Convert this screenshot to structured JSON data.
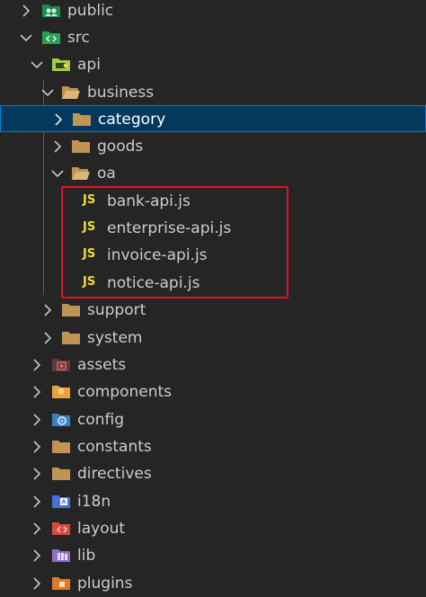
{
  "explorer": {
    "items": [
      {
        "label": "public",
        "icon": "folder-public-icon",
        "expanded": false
      },
      {
        "label": "src",
        "icon": "folder-src-icon",
        "expanded": true
      },
      {
        "label": "api",
        "icon": "folder-api-icon",
        "expanded": true
      },
      {
        "label": "business",
        "icon": "folder-icon",
        "expanded": true
      },
      {
        "label": "category",
        "icon": "folder-icon",
        "expanded": false,
        "selected": true
      },
      {
        "label": "goods",
        "icon": "folder-icon",
        "expanded": false
      },
      {
        "label": "oa",
        "icon": "folder-icon",
        "expanded": true
      },
      {
        "label": "bank-api.js",
        "icon": "js-file-icon"
      },
      {
        "label": "enterprise-api.js",
        "icon": "js-file-icon"
      },
      {
        "label": "invoice-api.js",
        "icon": "js-file-icon"
      },
      {
        "label": "notice-api.js",
        "icon": "js-file-icon"
      },
      {
        "label": "support",
        "icon": "folder-icon",
        "expanded": false
      },
      {
        "label": "system",
        "icon": "folder-icon",
        "expanded": false
      },
      {
        "label": "assets",
        "icon": "folder-assets-icon",
        "expanded": false
      },
      {
        "label": "components",
        "icon": "folder-components-icon",
        "expanded": false
      },
      {
        "label": "config",
        "icon": "folder-config-icon",
        "expanded": false
      },
      {
        "label": "constants",
        "icon": "folder-icon",
        "expanded": false
      },
      {
        "label": "directives",
        "icon": "folder-icon",
        "expanded": false
      },
      {
        "label": "i18n",
        "icon": "folder-i18n-icon",
        "expanded": false
      },
      {
        "label": "layout",
        "icon": "folder-layout-icon",
        "expanded": false
      },
      {
        "label": "lib",
        "icon": "folder-lib-icon",
        "expanded": false
      },
      {
        "label": "plugins",
        "icon": "folder-plugins-icon",
        "expanded": false
      }
    ],
    "js_badge": "JS"
  },
  "colors": {
    "background": "#252526",
    "selected_bg": "#04395e",
    "selected_border": "#007fd4",
    "highlight_box": "#e81123",
    "js_yellow": "#f1dd35",
    "folder_tan": "#c09553"
  }
}
